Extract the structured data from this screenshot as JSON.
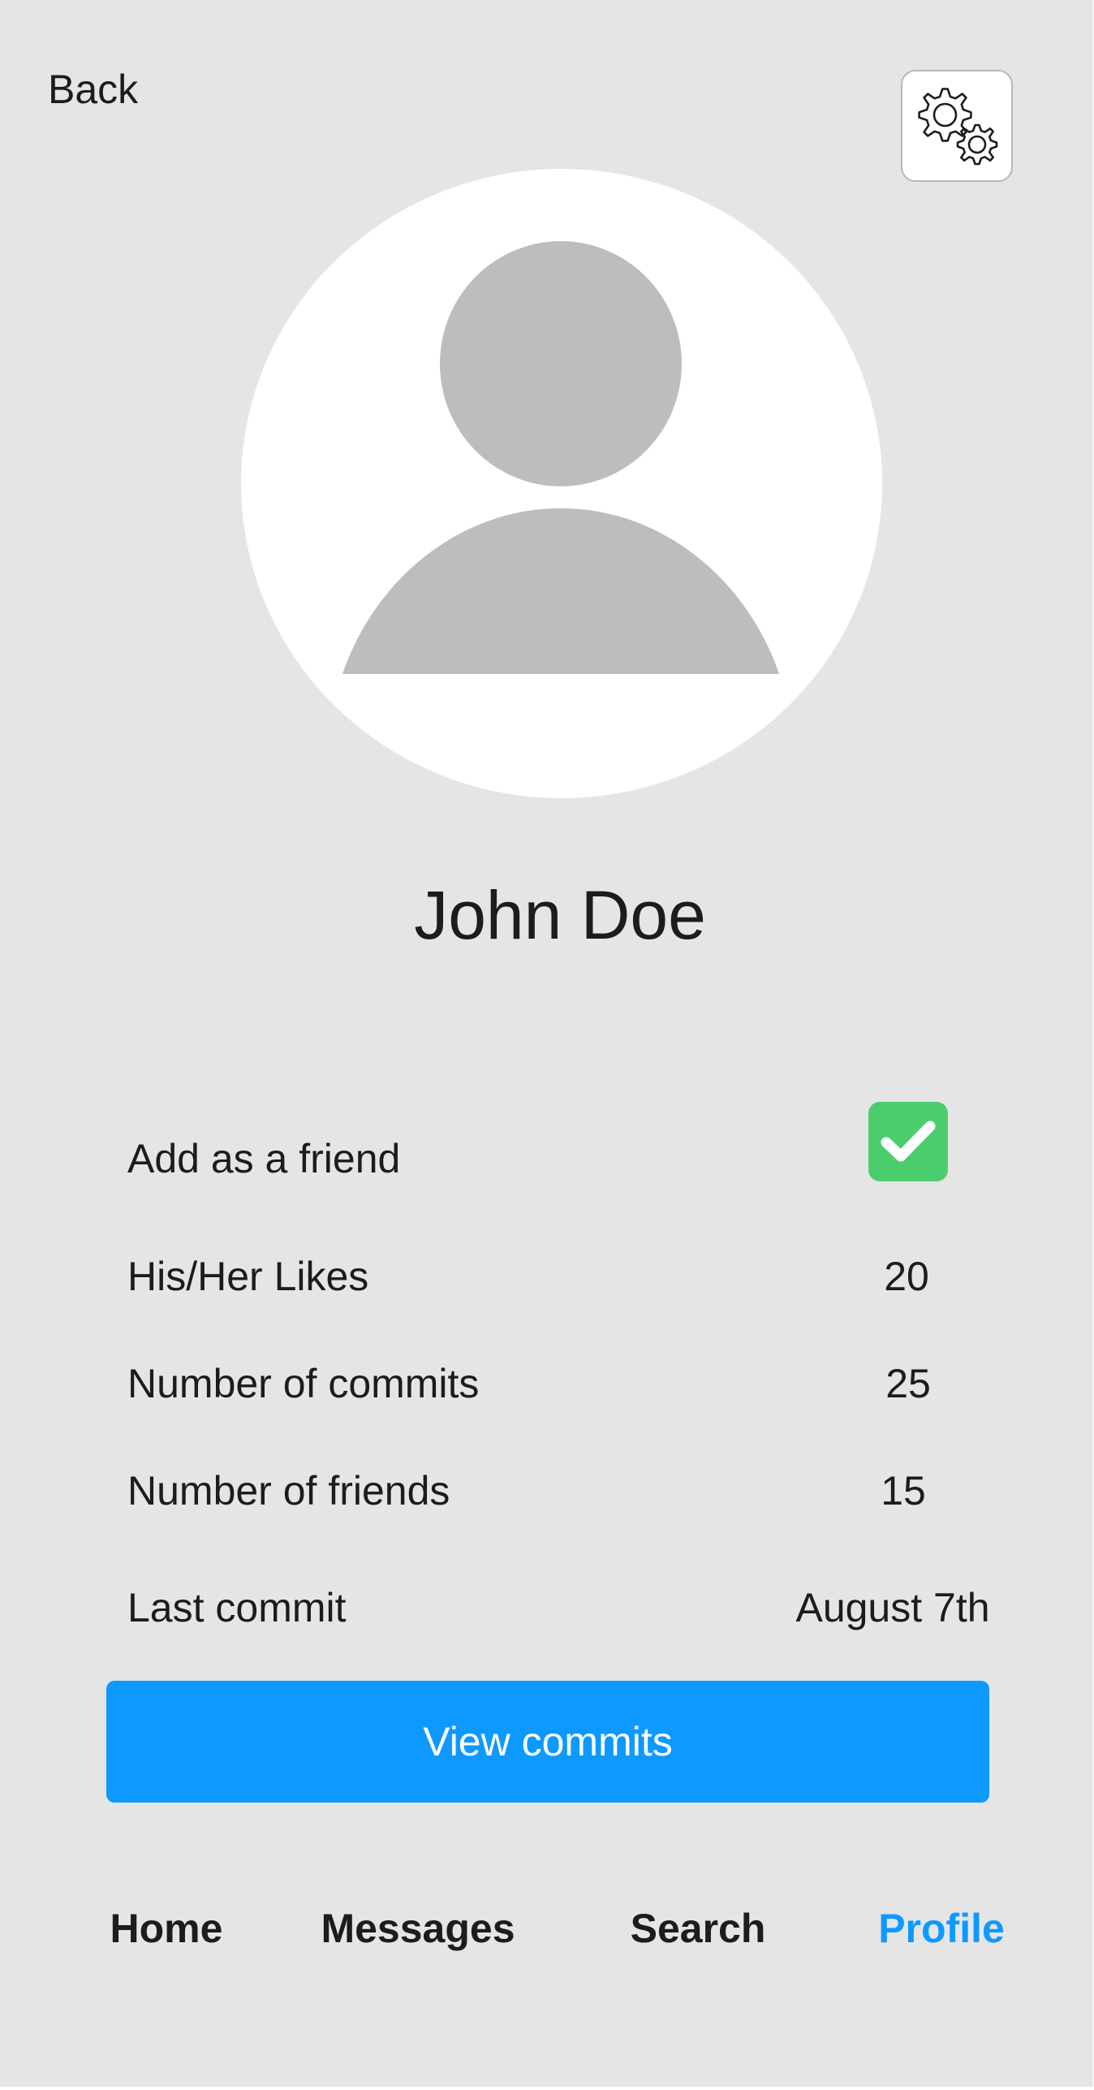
{
  "header": {
    "back_label": "Back",
    "settings_icon": "gears-icon"
  },
  "profile": {
    "avatar_icon": "person-placeholder-icon",
    "name": "John Doe"
  },
  "details": {
    "friend": {
      "label": "Add as a friend",
      "checked": true,
      "checkbox_color": "#4bcd6e"
    },
    "likes": {
      "label": "His/Her Likes",
      "value": "20"
    },
    "commits": {
      "label": "Number of commits",
      "value": "25"
    },
    "friends": {
      "label": "Number of friends",
      "value": "15"
    },
    "last_commit": {
      "label": "Last commit",
      "value": "August 7th"
    }
  },
  "view_commits_label": "View commits",
  "nav": {
    "home": "Home",
    "messages": "Messages",
    "search": "Search",
    "profile": "Profile",
    "active": "profile"
  },
  "colors": {
    "background": "#e5e5e6",
    "accent": "#0d99ff",
    "avatar_fill": "#bdbdbd",
    "text": "#1c1c1e"
  }
}
